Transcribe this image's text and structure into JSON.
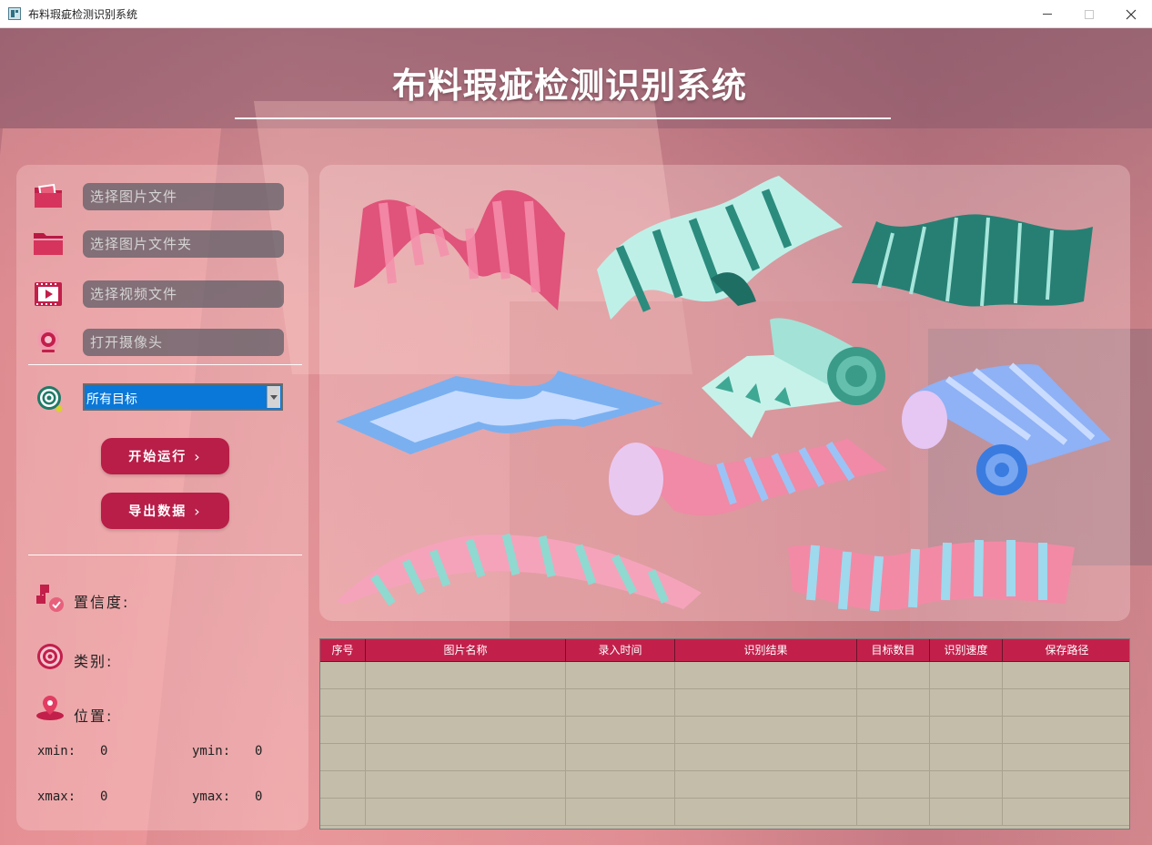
{
  "window": {
    "title": "布料瑕疵检测识别系统",
    "minimize_glyph": "—",
    "maximize_glyph": "☐",
    "close_glyph": "✕"
  },
  "header": {
    "title": "布料瑕疵检测识别系统"
  },
  "controls": {
    "image_file_placeholder": "选择图片文件",
    "image_folder_placeholder": "选择图片文件夹",
    "video_file_placeholder": "选择视频文件",
    "camera_placeholder": "打开摄像头",
    "target_select": {
      "selected": "所有目标"
    },
    "start_button": "开始运行",
    "export_button": "导出数据",
    "button_chevron": "›"
  },
  "info": {
    "confidence_label": "置信度:",
    "class_label": "类别:",
    "position_label": "位置:",
    "xmin_label": "xmin:",
    "xmin_value": "0",
    "ymin_label": "ymin:",
    "ymin_value": "0",
    "xmax_label": "xmax:",
    "xmax_value": "0",
    "ymax_label": "ymax:",
    "ymax_value": "0"
  },
  "table": {
    "columns": [
      "序号",
      "图片名称",
      "录入时间",
      "识别结果",
      "目标数目",
      "识别速度",
      "保存路径"
    ],
    "rows": []
  },
  "colors": {
    "accent": "#b81e48",
    "table_header": "#c2204b",
    "table_body": "#c4bda9",
    "select_highlight": "#0a78d8"
  },
  "icons": {
    "image_file": "image-folder-icon",
    "image_folder": "folder-icon",
    "video": "video-icon",
    "camera": "camera-icon",
    "target": "target-icon",
    "confidence": "confidence-icon",
    "class": "class-icon",
    "position": "location-pin-icon"
  }
}
